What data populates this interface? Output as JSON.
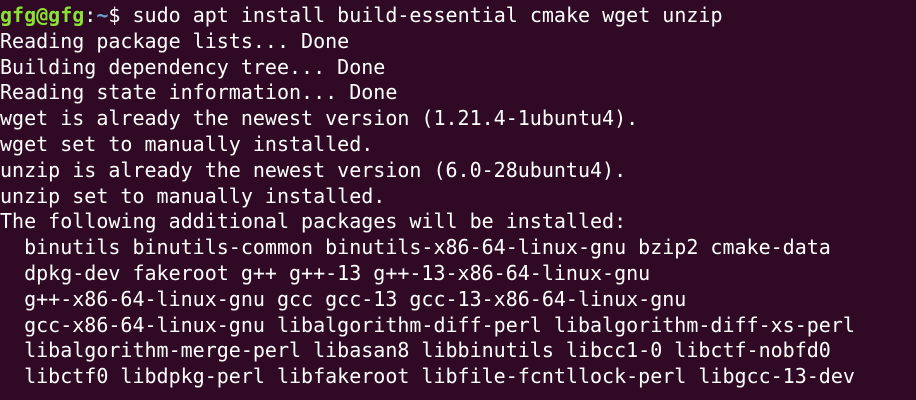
{
  "terminal": {
    "background": "#300a24",
    "foreground": "#ffffff",
    "prompt": {
      "user_host": "gfg@gfg",
      "separator": ":",
      "path": "~",
      "symbol": "$ ",
      "user_color": "#8ae234",
      "path_color": "#729fcf"
    },
    "command": "sudo apt install build-essential cmake wget unzip",
    "output": [
      "Reading package lists... Done",
      "Building dependency tree... Done",
      "Reading state information... Done",
      "wget is already the newest version (1.21.4-1ubuntu4).",
      "wget set to manually installed.",
      "unzip is already the newest version (6.0-28ubuntu4).",
      "unzip set to manually installed.",
      "The following additional packages will be installed:",
      "  binutils binutils-common binutils-x86-64-linux-gnu bzip2 cmake-data",
      "  dpkg-dev fakeroot g++ g++-13 g++-13-x86-64-linux-gnu",
      "  g++-x86-64-linux-gnu gcc gcc-13 gcc-13-x86-64-linux-gnu",
      "  gcc-x86-64-linux-gnu libalgorithm-diff-perl libalgorithm-diff-xs-perl",
      "  libalgorithm-merge-perl libasan8 libbinutils libcc1-0 libctf-nobfd0",
      "  libctf0 libdpkg-perl libfakeroot libfile-fcntllock-perl libgcc-13-dev"
    ]
  }
}
